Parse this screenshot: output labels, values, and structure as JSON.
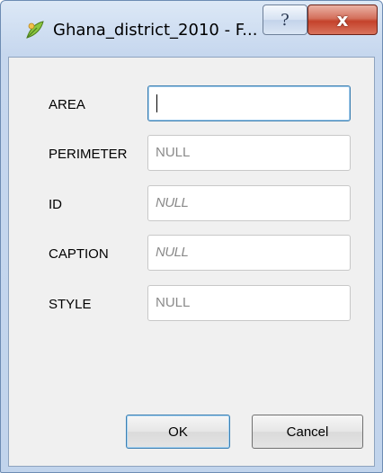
{
  "window": {
    "title": "Ghana_district_2010 - F...",
    "help_glyph": "?",
    "close_glyph": "x"
  },
  "fields": [
    {
      "label": "AREA",
      "value": ""
    },
    {
      "label": "PERIMETER",
      "value": "NULL"
    },
    {
      "label": "ID",
      "value": "NULL"
    },
    {
      "label": "CAPTION",
      "value": "NULL"
    },
    {
      "label": "STYLE",
      "value": "NULL"
    }
  ],
  "buttons": {
    "ok_label": "OK",
    "cancel_label": "Cancel"
  },
  "colors": {
    "focus_border": "#3c7fb1",
    "close_red": "#c4422b",
    "app_icon_green": "#8cc63f"
  },
  "icons": {
    "app": "qgis-leaf-icon",
    "help": "help-icon",
    "close": "close-icon"
  }
}
